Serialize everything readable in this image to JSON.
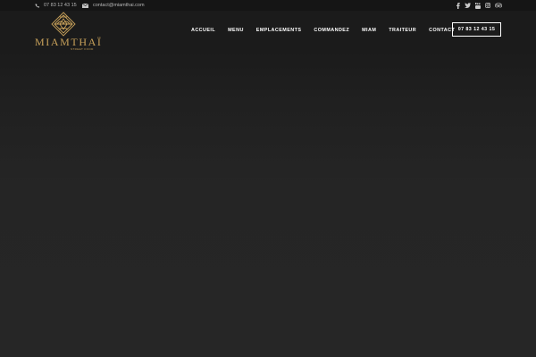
{
  "topbar": {
    "phone": "07 83 12 43 15",
    "email": "contact@miamthai.com",
    "social_icons": [
      "facebook-icon",
      "twitter-icon",
      "youtube-icon",
      "instagram-icon",
      "tripadvisor-icon"
    ]
  },
  "brand": {
    "name": "MIAMTHAÏ",
    "tagline": "STREET FOOD",
    "accent_color": "#c8a15a"
  },
  "nav": {
    "items": [
      "ACCUEIL",
      "MENU",
      "EMPLACEMENTS",
      "COMMANDEZ",
      "MIAM",
      "TRAITEUR",
      "CONTACT"
    ],
    "phone_button": "07 83 12 43 15"
  },
  "colors": {
    "topbar": "#151515",
    "header": "#1b1b1b",
    "hero": "#262626"
  }
}
